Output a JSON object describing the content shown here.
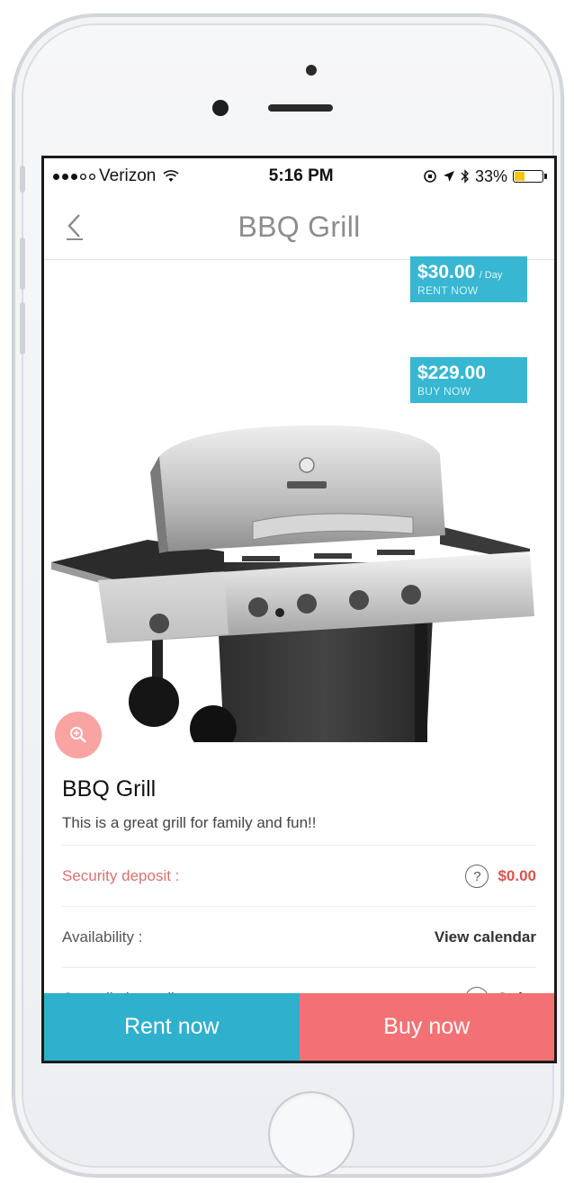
{
  "status_bar": {
    "carrier": "Verizon",
    "time": "5:16 PM",
    "battery_percent": "33%",
    "battery_level": 0.33,
    "signal_bars": 3,
    "signal_total": 5
  },
  "nav": {
    "title": "BBQ Grill",
    "back_icon": "chevron-left-icon"
  },
  "product": {
    "rent_price": "$30.00",
    "rent_unit": "/ Day",
    "rent_cta": "RENT NOW",
    "buy_price": "$229.00",
    "buy_cta": "BUY NOW",
    "title": "BBQ Grill",
    "description": "This is a great grill for family and fun!!"
  },
  "details": {
    "security_label": "Security deposit :",
    "security_value": "$0.00",
    "availability_label": "Availability :",
    "availability_value": "View calendar",
    "cancellation_label": "Cancellation policy :",
    "cancellation_value": "Strict"
  },
  "actions": {
    "rent_label": "Rent now",
    "buy_label": "Buy now"
  },
  "colors": {
    "accent_blue": "#2fb0cc",
    "accent_red": "#f37174",
    "zoom_pink": "#f9a3a3"
  }
}
